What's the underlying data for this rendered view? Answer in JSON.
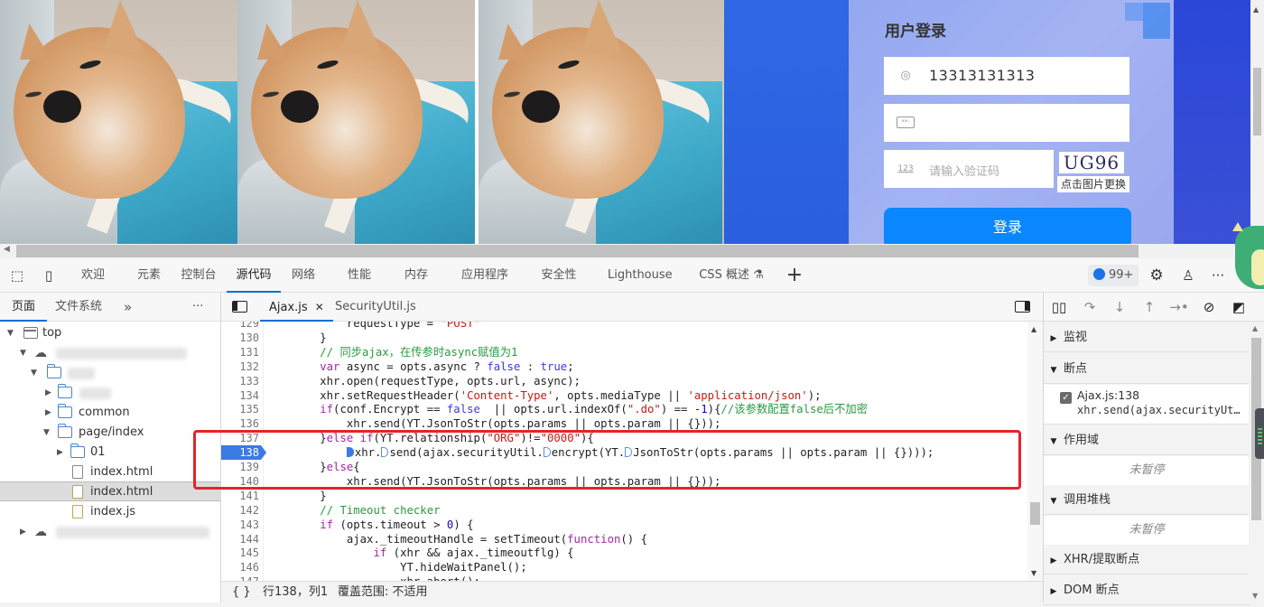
{
  "page": {
    "images": [
      {
        "alt": "sleeping shiba inu dog in blue blanket"
      },
      {
        "alt": "sleeping shiba inu dog in blue blanket"
      },
      {
        "alt": "sleeping shiba inu dog in blue blanket"
      }
    ],
    "login": {
      "title": "用户登录",
      "username_value": "13313131313",
      "username_icon": "user-icon",
      "password_value": "",
      "password_icon": "password-icon",
      "captcha_placeholder": "请输入验证码",
      "captcha_icon": "captcha-icon",
      "captcha_icon_text": "123",
      "captcha_image_text": "UG96",
      "captcha_hint": "点击图片更换",
      "submit_label": "登录"
    }
  },
  "devtools": {
    "toolbar": {
      "inspect_icon": "inspect-element-icon",
      "device_icon": "device-emulation-icon",
      "tabs": [
        {
          "label": "欢迎",
          "active": false
        },
        {
          "label": "元素",
          "active": false
        },
        {
          "label": "控制台",
          "active": false
        },
        {
          "label": "源代码",
          "active": true
        },
        {
          "label": "网络",
          "active": false
        },
        {
          "label": "性能",
          "active": false
        },
        {
          "label": "内存",
          "active": false
        },
        {
          "label": "应用程序",
          "active": false
        },
        {
          "label": "安全性",
          "active": false
        },
        {
          "label": "Lighthouse",
          "active": false
        },
        {
          "label": "CSS 概述 ⚗",
          "active": false
        }
      ],
      "add_tab": "+",
      "issues_count": "99+",
      "more": "···"
    },
    "navigator": {
      "tabs": [
        {
          "label": "页面",
          "active": true
        },
        {
          "label": "文件系统",
          "active": false
        }
      ],
      "overflow": "»",
      "more": "···",
      "tree": [
        {
          "label": "top",
          "type": "frame",
          "expanded": true,
          "depth": 0
        },
        {
          "label": "",
          "type": "cloud",
          "expanded": true,
          "depth": 1,
          "blurred": true
        },
        {
          "label": "",
          "type": "folder",
          "expanded": true,
          "depth": 2,
          "blurred": true
        },
        {
          "label": "",
          "type": "folder",
          "expanded": false,
          "depth": 3,
          "blurred": true
        },
        {
          "label": "common",
          "type": "folder",
          "expanded": false,
          "depth": 3
        },
        {
          "label": "page/index",
          "type": "folder",
          "expanded": true,
          "depth": 3
        },
        {
          "label": "01",
          "type": "folder",
          "expanded": false,
          "depth": 4
        },
        {
          "label": "index.html",
          "type": "file",
          "depth": 4
        },
        {
          "label": "index.html",
          "type": "file",
          "depth": 4,
          "selected": true
        },
        {
          "label": "index.js",
          "type": "file-js",
          "depth": 4
        },
        {
          "label": "",
          "type": "cloud",
          "expanded": false,
          "depth": 1,
          "blurred": true
        }
      ]
    },
    "editor": {
      "tabs": [
        {
          "label": "Ajax.js",
          "active": true,
          "closable": true
        },
        {
          "label": "SecurityUtil.js",
          "active": false
        }
      ],
      "breakpoint_line": 138,
      "lines": [
        {
          "n": "129",
          "code": "            requestType = \"POST\""
        },
        {
          "n": "130",
          "code": "        }"
        },
        {
          "n": "131",
          "code": "        // 同步ajax，在传参时async赋值为1"
        },
        {
          "n": "132",
          "code": "        var async = opts.async ? false : true;"
        },
        {
          "n": "133",
          "code": "        xhr.open(requestType, opts.url, async);"
        },
        {
          "n": "134",
          "code": "        xhr.setRequestHeader('Content-Type', opts.mediaType || 'application/json');"
        },
        {
          "n": "135",
          "code": "        if(conf.Encrypt == false  || opts.url.indexOf(\".do\") == -1){//该参数配置false后不加密"
        },
        {
          "n": "136",
          "code": "            xhr.send(YT.JsonToStr(opts.params || opts.param || {}));"
        },
        {
          "n": "137",
          "code": "        }else if(YT.relationship(\"ORG\")!=\"0000\"){"
        },
        {
          "n": "138",
          "code": "            xhr.send(ajax.securityUtil.encrypt(YT.JsonToStr(opts.params || opts.param || {})));"
        },
        {
          "n": "139",
          "code": "        }else{"
        },
        {
          "n": "140",
          "code": "            xhr.send(YT.JsonToStr(opts.params || opts.param || {}));"
        },
        {
          "n": "141",
          "code": "        }"
        },
        {
          "n": "142",
          "code": "        // Timeout checker"
        },
        {
          "n": "143",
          "code": "        if (opts.timeout > 0) {"
        },
        {
          "n": "144",
          "code": "            ajax._timeoutHandle = setTimeout(function() {"
        },
        {
          "n": "145",
          "code": "                if (xhr && ajax._timeoutflg) {"
        },
        {
          "n": "146",
          "code": "                    YT.hideWaitPanel();"
        },
        {
          "n": "147",
          "code": "                    xhr.abort();"
        }
      ],
      "status": {
        "format_icon": "{ }",
        "position": "行138，列1",
        "coverage": "覆盖范围: 不适用"
      }
    },
    "debugger": {
      "controls": [
        "pause-resume",
        "step-over",
        "step-into",
        "step-out",
        "step",
        "deactivate-breakpoints",
        "pause-on-exceptions"
      ],
      "sections": {
        "watch": "监视",
        "breakpoints": "断点",
        "scope": "作用域",
        "call_stack": "调用堆栈",
        "xhr_breakpoints": "XHR/提取断点",
        "dom_breakpoints": "DOM 断点"
      },
      "breakpoint_item": {
        "checked": true,
        "location": "Ajax.js:138",
        "code": "xhr.send(ajax.securityUt…"
      },
      "not_paused": "未暂停"
    }
  },
  "colors": {
    "accent": "#0a6ed1",
    "breakpoint": "#3b7ae3",
    "highlight_box": "#e3242b",
    "login_button": "#0a87ff"
  }
}
